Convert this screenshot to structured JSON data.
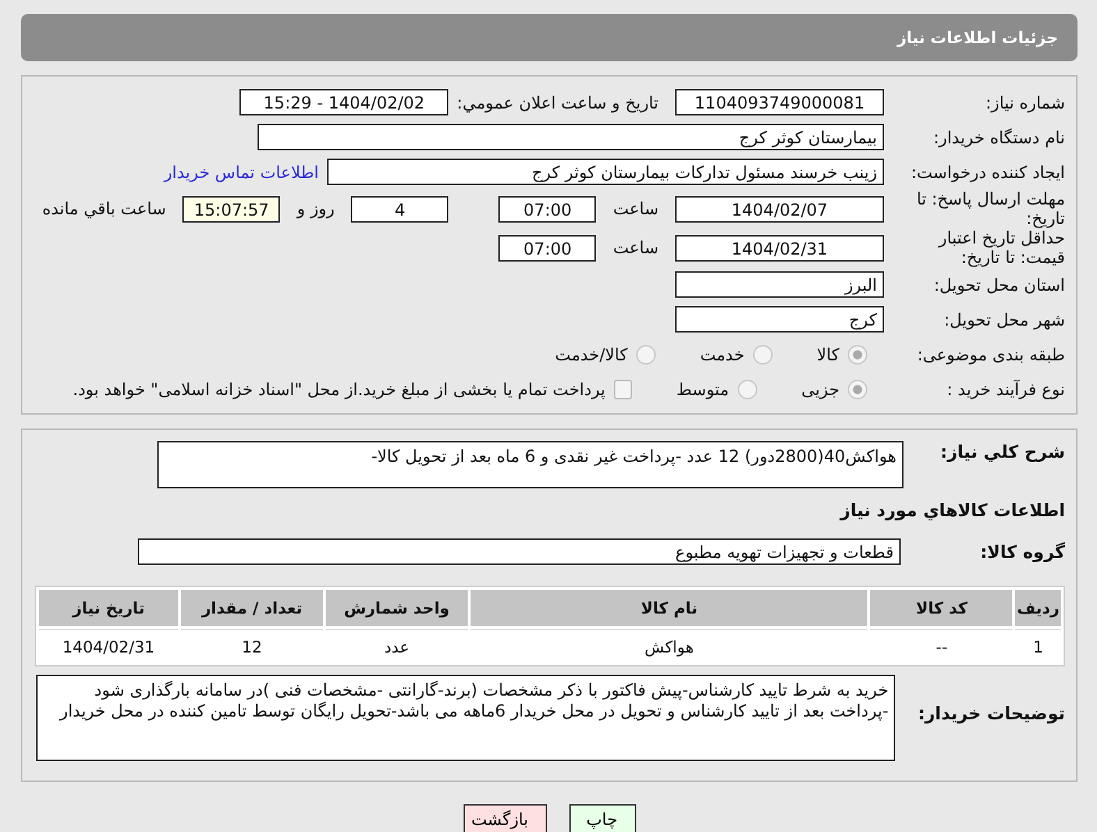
{
  "title": "جزئیات اطلاعات نیاز",
  "need_number": {
    "label": "شماره نیاز:",
    "value": "1104093749000081"
  },
  "announce": {
    "label": "تاریخ و ساعت اعلان عمومي:",
    "value": "1404/02/02 - 15:29"
  },
  "buyer_org": {
    "label": "نام دستگاه خریدار:",
    "value": "بیمارستان کوثر کرج"
  },
  "creator": {
    "label": "ایجاد کننده درخواست:",
    "value": "زینب خرسند مسئول تدارکات بیمارستان کوثر کرج",
    "link": "اطلاعات تماس خریدار"
  },
  "deadline": {
    "label": "مهلت ارسال پاسخ: تا تاریخ:",
    "date": "1404/02/07",
    "time_label": "ساعت",
    "time": "07:00",
    "days": "4",
    "days_label": "روز و",
    "remaining": "15:07:57",
    "remaining_label": "ساعت باقي مانده"
  },
  "validity": {
    "label": "حداقل تاریخ اعتبار قیمت: تا تاریخ:",
    "date": "1404/02/31",
    "time_label": "ساعت",
    "time": "07:00"
  },
  "province": {
    "label": "استان محل تحویل:",
    "value": "البرز"
  },
  "city": {
    "label": "شهر محل تحویل:",
    "value": "کرج"
  },
  "category": {
    "label": "طبقه بندی موضوعی:",
    "options": [
      {
        "label": "کالا",
        "selected": true
      },
      {
        "label": "خدمت",
        "selected": false
      },
      {
        "label": "کالا/خدمت",
        "selected": false
      }
    ]
  },
  "purchase_type": {
    "label": "نوع فرآیند خرید :",
    "options": [
      {
        "label": "جزیی",
        "selected": true
      },
      {
        "label": "متوسط",
        "selected": false
      }
    ],
    "treasury": {
      "label": "پرداخت تمام یا بخشی از مبلغ خرید.از محل \"اسناد خزانه اسلامی\" خواهد بود.",
      "checked": false
    }
  },
  "description": {
    "label": "شرح کلي نياز:",
    "value": "هواکش40(2800دور)   12 عدد -پرداخت غیر نقدی و 6 ماه بعد از تحویل کالا-"
  },
  "items_heading": "اطلاعات کالاهاي مورد نياز",
  "goods_group": {
    "label": "گروه کالا:",
    "value": "قطعات و تجهیزات تهویه مطبوع"
  },
  "table": {
    "columns": [
      "ردیف",
      "کد کالا",
      "نام کالا",
      "واحد شمارش",
      "تعداد / مقدار",
      "تاریخ نیاز"
    ],
    "rows": [
      [
        "1",
        "--",
        "هواکش",
        "عدد",
        "12",
        "1404/02/31"
      ]
    ]
  },
  "buyer_notes": {
    "label": "توضیحات خریدار:",
    "value": "خرید به شرط تایید کارشناس-پیش فاکتور با ذکر مشخصات (برند-گارانتی -مشخصات فنی )در سامانه بارگذاری شود -پرداخت بعد از تایید کارشناس و تحویل در محل خریدار 6ماهه می باشد-تحویل رایگان توسط تامین کننده در محل خریدار"
  },
  "buttons": [
    {
      "label": "چاپ",
      "kind": "print"
    },
    {
      "label": "بازگشت",
      "kind": "back"
    }
  ]
}
